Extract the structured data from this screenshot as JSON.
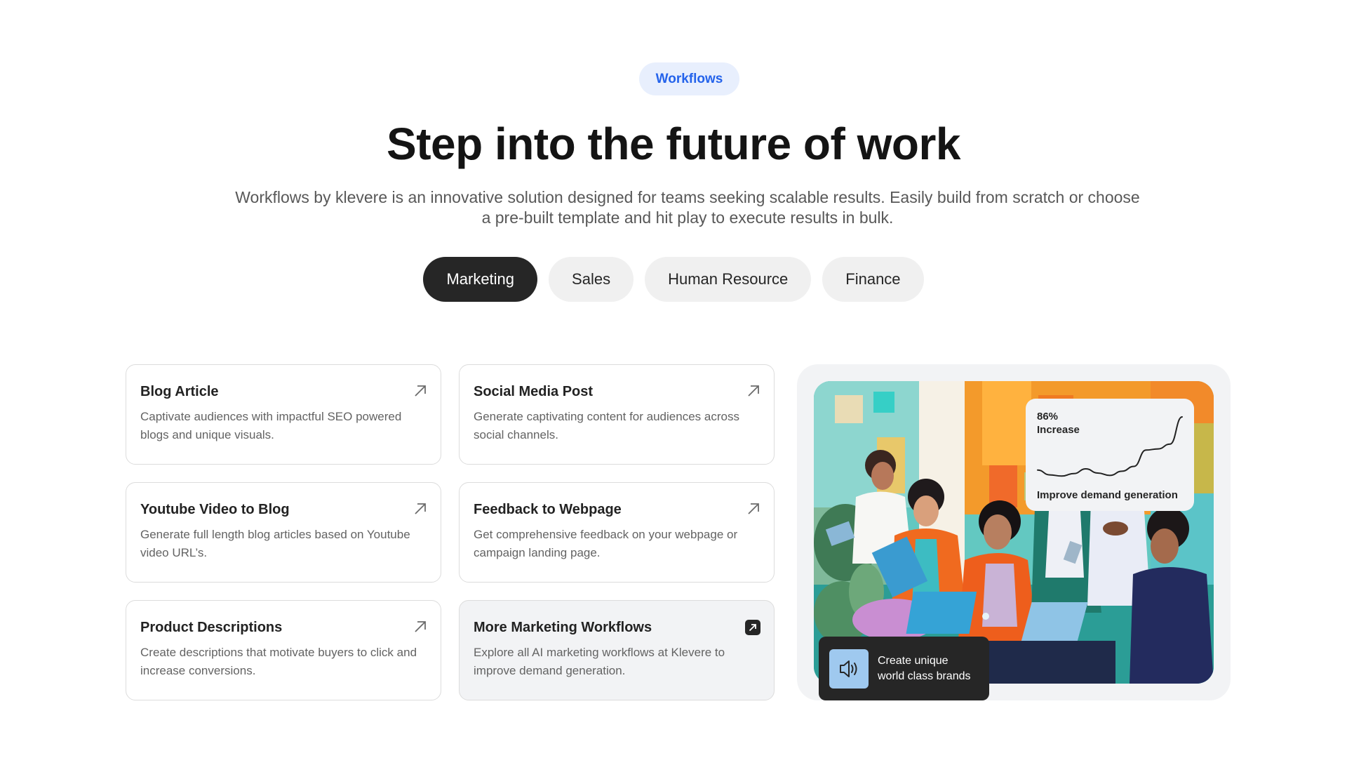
{
  "header": {
    "badge": "Workflows",
    "title": "Step into the future of work",
    "subtitle": "Workflows by klevere is an innovative solution designed for teams seeking scalable results. Easily build from scratch or choose a pre-built template and hit play to execute results in bulk."
  },
  "tabs": [
    {
      "label": "Marketing",
      "active": true
    },
    {
      "label": "Sales",
      "active": false
    },
    {
      "label": "Human Resource",
      "active": false
    },
    {
      "label": "Finance",
      "active": false
    }
  ],
  "cards": [
    {
      "title": "Blog Article",
      "description": "Captivate audiences with impactful SEO powered blogs and unique visuals.",
      "icon": "arrow-up-right-icon"
    },
    {
      "title": "Social Media Post",
      "description": "Generate captivating content for audiences across social channels.",
      "icon": "arrow-up-right-icon"
    },
    {
      "title": "Youtube Video to Blog",
      "description": "Generate full length blog articles based on Youtube video URL’s.",
      "icon": "arrow-up-right-icon"
    },
    {
      "title": "Feedback to Webpage",
      "description": "Get comprehensive feedback on your webpage or campaign landing page.",
      "icon": "arrow-up-right-icon"
    },
    {
      "title": "Product Descriptions",
      "description": "Create descriptions that motivate buyers to click and increase conversions.",
      "icon": "arrow-up-right-icon"
    },
    {
      "title": "More Marketing Workflows",
      "description": "Explore all AI marketing workflows at Klevere to improve demand generation.",
      "icon": "arrow-up-right-box-icon"
    }
  ],
  "showcase": {
    "image": "illustration-people-working-on-laptops",
    "stat": {
      "value": "86%",
      "label": "Increase",
      "caption": "Improve demand generation",
      "trend": [
        0.12,
        0.04,
        0.02,
        0.06,
        0.14,
        0.07,
        0.03,
        0.1,
        0.18,
        0.45,
        0.47,
        0.55,
        1.0
      ]
    },
    "tooltip": {
      "icon": "speaker-icon",
      "line1": "Create unique",
      "line2": "world class brands"
    }
  },
  "colors": {
    "accent_blue": "#2463eb",
    "badge_bg": "#e8effd",
    "active_tab": "#262626",
    "tab_bg": "#f0f0f0",
    "panel_bg": "#f2f3f5",
    "tooltip_icon_bg": "#9fc9ef"
  }
}
